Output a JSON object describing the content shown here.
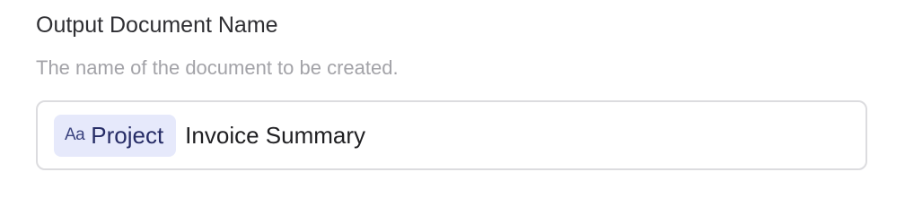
{
  "field": {
    "label": "Output Document Name",
    "description": "The name of the document to be created.",
    "chip": {
      "icon": "text-type-icon",
      "icon_glyph": "Aa",
      "label": "Project"
    },
    "value": "Invoice Summary"
  },
  "colors": {
    "chip_background": "#e6e9fb",
    "chip_text": "#262c66",
    "description_text": "#a3a3a8",
    "input_border": "#dcdcdf"
  }
}
